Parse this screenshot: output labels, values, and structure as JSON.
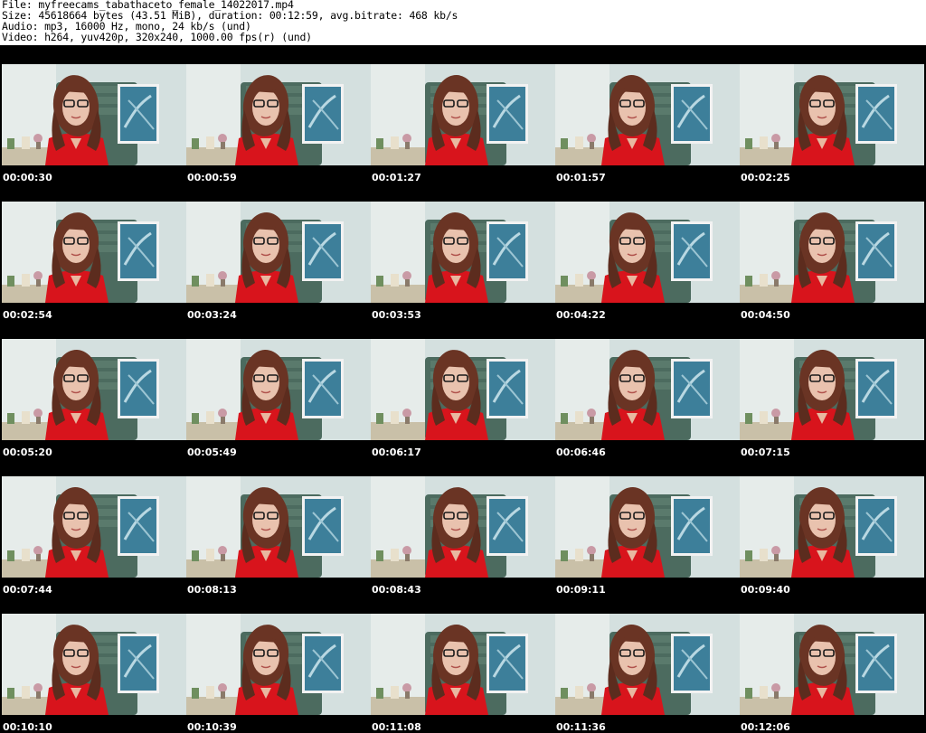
{
  "header": {
    "line1": "File: myfreecams_tabathaceto_female_14022017.mp4",
    "line2": "Size: 45618664 bytes (43.51 MiB), duration: 00:12:59, avg.bitrate: 468 kb/s",
    "line3": "Audio: mp3, 16000 Hz, mono, 24 kb/s (und)",
    "line4": "Video: h264, yuv420p, 320x240, 1000.00 fps(r) (und)"
  },
  "thumbnails": [
    {
      "timestamp": "00:00:30"
    },
    {
      "timestamp": "00:00:59"
    },
    {
      "timestamp": "00:01:27"
    },
    {
      "timestamp": "00:01:57"
    },
    {
      "timestamp": "00:02:25"
    },
    {
      "timestamp": "00:02:54"
    },
    {
      "timestamp": "00:03:24"
    },
    {
      "timestamp": "00:03:53"
    },
    {
      "timestamp": "00:04:22"
    },
    {
      "timestamp": "00:04:50"
    },
    {
      "timestamp": "00:05:20"
    },
    {
      "timestamp": "00:05:49"
    },
    {
      "timestamp": "00:06:17"
    },
    {
      "timestamp": "00:06:46"
    },
    {
      "timestamp": "00:07:15"
    },
    {
      "timestamp": "00:07:44"
    },
    {
      "timestamp": "00:08:13"
    },
    {
      "timestamp": "00:08:43"
    },
    {
      "timestamp": "00:09:11"
    },
    {
      "timestamp": "00:09:40"
    },
    {
      "timestamp": "00:10:10"
    },
    {
      "timestamp": "00:10:39"
    },
    {
      "timestamp": "00:11:08"
    },
    {
      "timestamp": "00:11:36"
    },
    {
      "timestamp": "00:12:06"
    }
  ]
}
